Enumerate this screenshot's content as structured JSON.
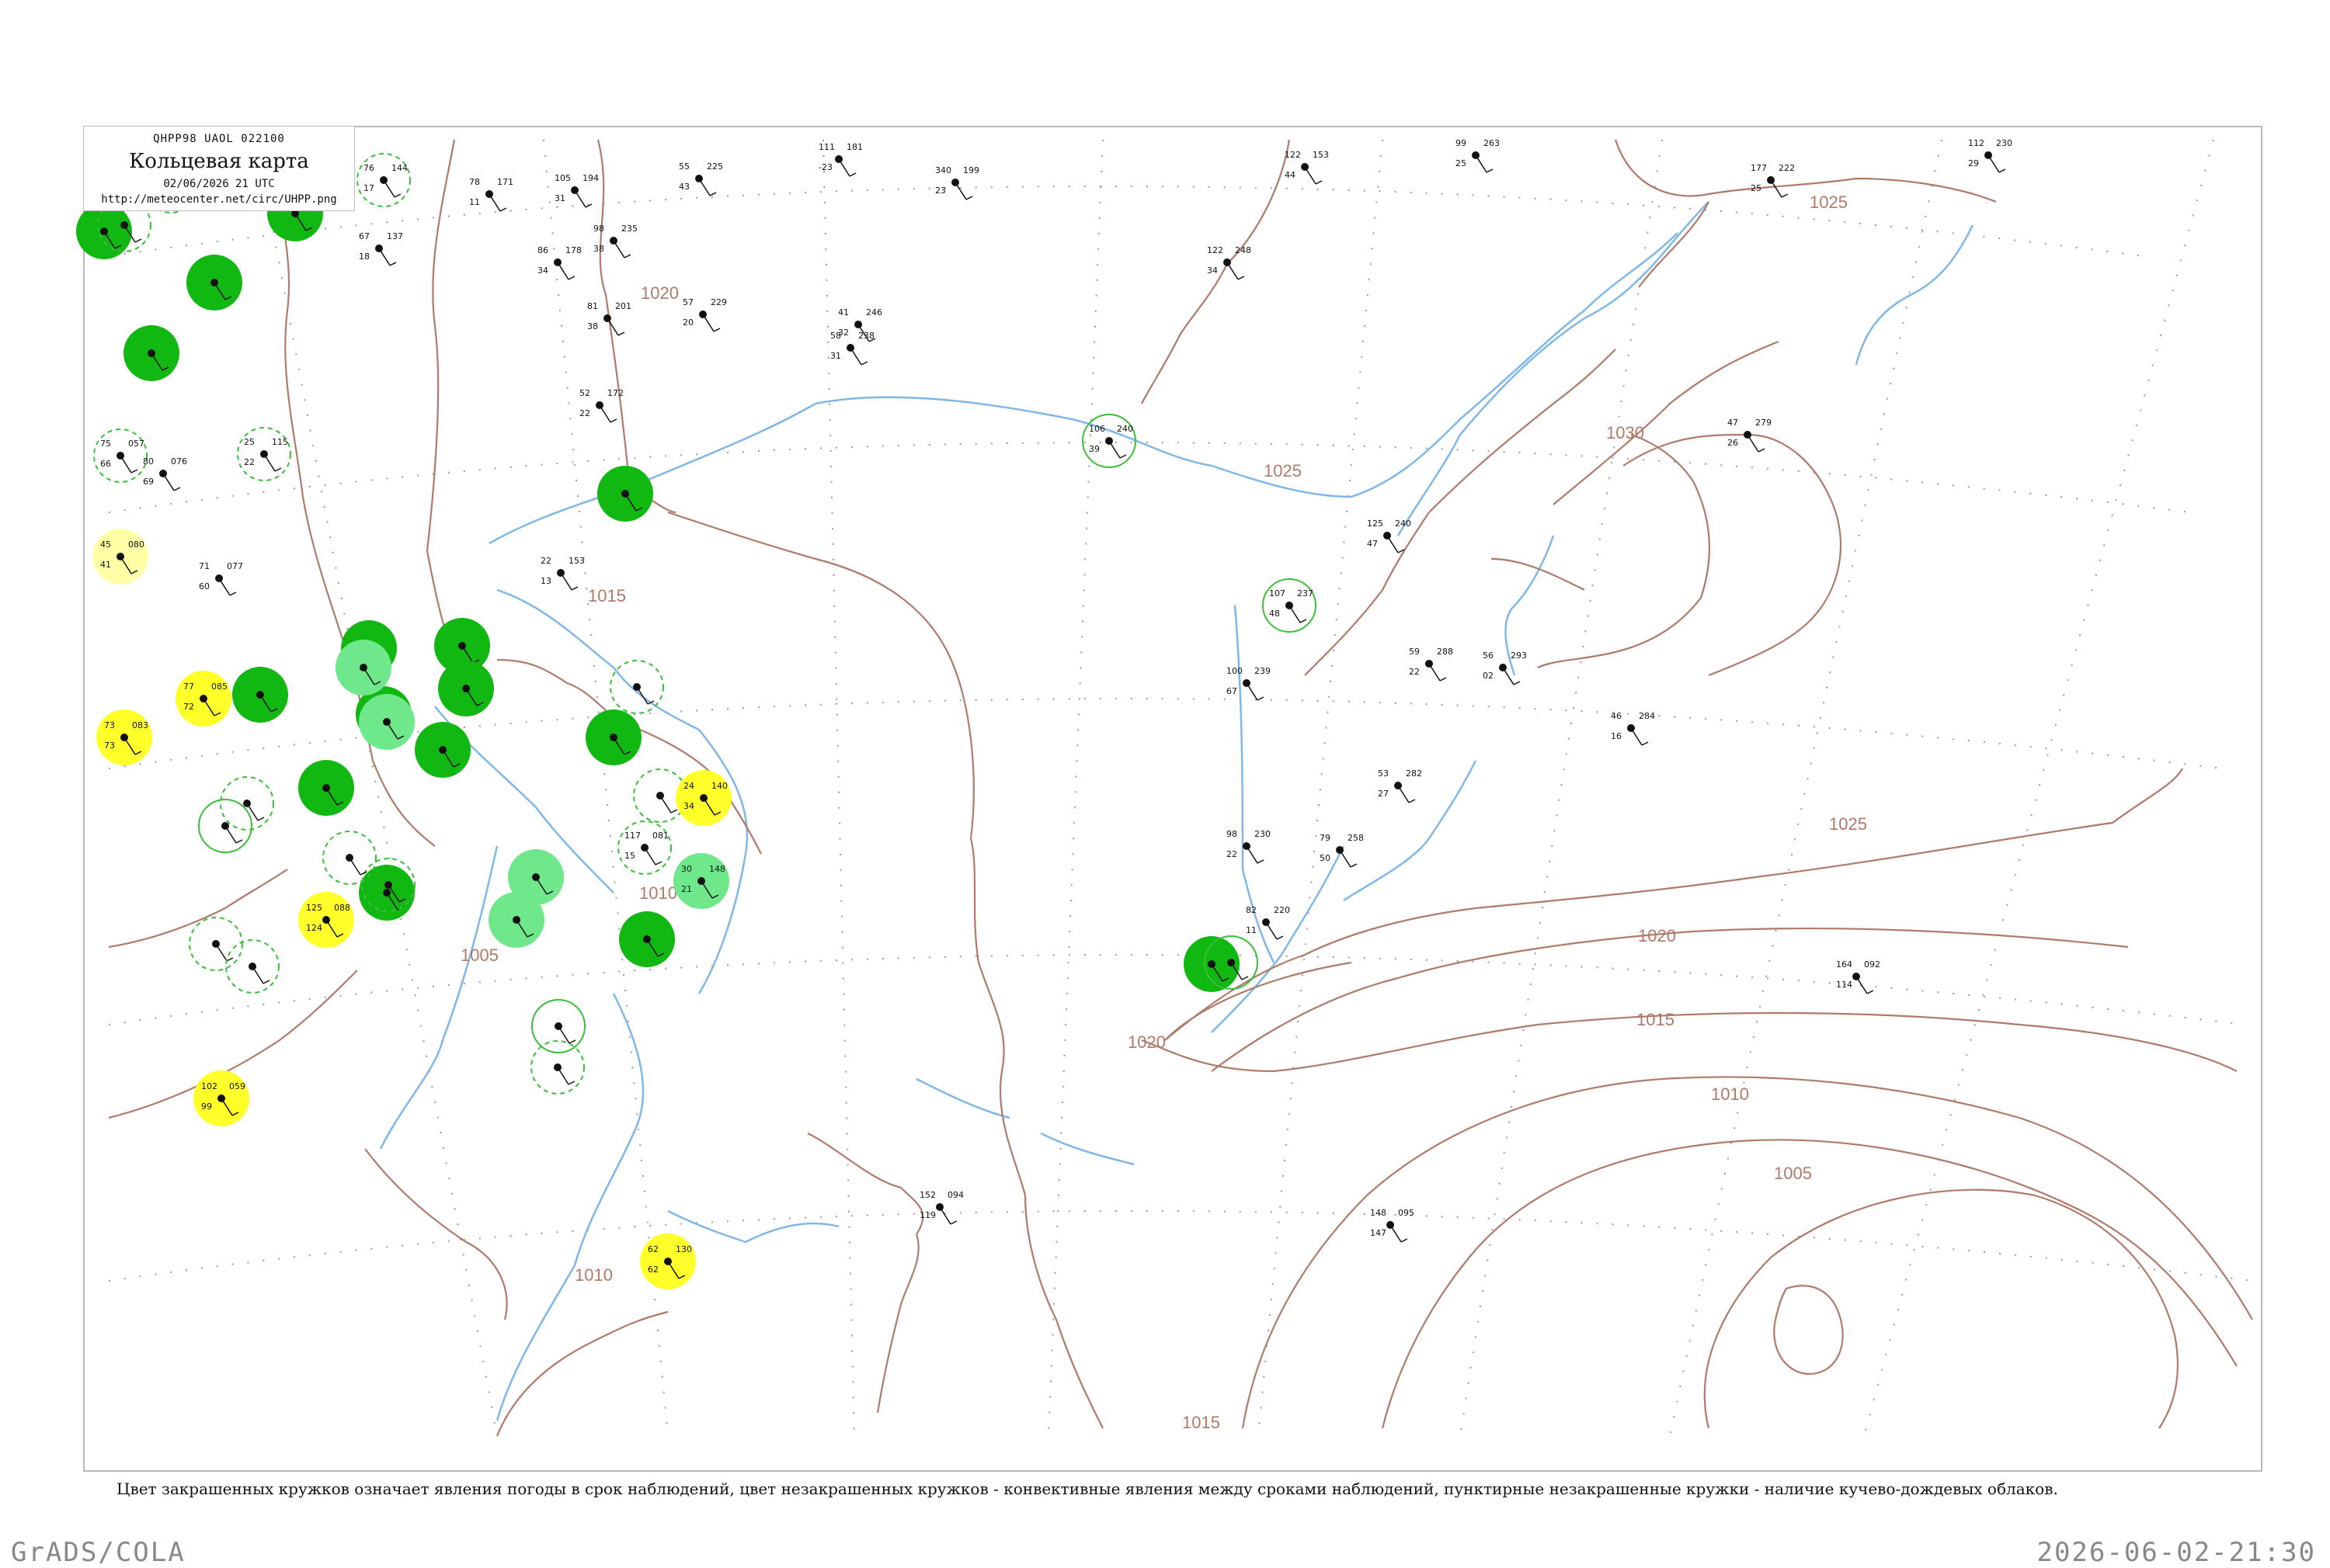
{
  "header": {
    "code": "QHPP98  UAOL  022100",
    "title": "Кольцевая карта",
    "time": "02/06/2026 21 UTC",
    "url": "http://meteocenter.net/circ/UHPP.png"
  },
  "footnote": "Цвет закрашенных кружков означает явления погоды в срок наблюдений, цвет незакрашенных кружков - конвективные явления между сроками наблюдений, пунктирные незакрашенные кружки - наличие кучево-дождевых облаков.",
  "credit": "GrADS/COLA",
  "timestamp": "2026-06-02-21:30",
  "isobar_labels": [
    "1025",
    "1020",
    "1030",
    "1025",
    "1015",
    "1025",
    "1020",
    "1015",
    "1010",
    "1005",
    "1020",
    "1010",
    "1005",
    "1010",
    "1015"
  ],
  "colors": {
    "isobar": "#b07a6a",
    "river": "#7fb8e8",
    "grid": "#9a9a9a",
    "station_green_dark": "#12b812",
    "station_green_light": "#6ee88a",
    "station_yellow": "#ffff2a",
    "station_pale_yellow": "#ffffa8",
    "text": "#111111",
    "footer_text": "#888888"
  },
  "stations": [
    {
      "label": "144",
      "t": "76",
      "td": "17"
    },
    {
      "label": "171",
      "t": "78",
      "td": "11"
    },
    {
      "label": "194",
      "t": "105",
      "td": "31"
    },
    {
      "label": "225",
      "t": "55",
      "td": "43"
    },
    {
      "label": "181",
      "t": "111",
      "td": "-23"
    },
    {
      "label": "199",
      "t": "340",
      "td": "23"
    },
    {
      "label": "153",
      "t": "122",
      "td": "44"
    },
    {
      "label": "263",
      "t": "99",
      "td": "25"
    },
    {
      "label": "222",
      "t": "177",
      "td": "25"
    },
    {
      "label": "230",
      "t": "112",
      "td": "29"
    },
    {
      "label": "137",
      "t": "67",
      "td": "18"
    },
    {
      "label": "235",
      "t": "98",
      "td": "38"
    },
    {
      "label": "178",
      "t": "86",
      "td": "34"
    },
    {
      "label": "248",
      "t": "122",
      "td": "34"
    },
    {
      "label": "201",
      "t": "81",
      "td": "38"
    },
    {
      "label": "229",
      "t": "57",
      "td": "20"
    },
    {
      "label": "246",
      "t": "41",
      "td": "32"
    },
    {
      "label": "238",
      "t": "58",
      "td": "31"
    },
    {
      "label": "172",
      "t": "52",
      "td": "22"
    },
    {
      "label": "240",
      "t": "106",
      "td": "39"
    },
    {
      "label": "279",
      "t": "47",
      "td": "26"
    },
    {
      "label": "057",
      "t": "75",
      "td": "66"
    },
    {
      "label": "115",
      "t": "25",
      "td": "22"
    },
    {
      "label": "076",
      "t": "80",
      "td": "69"
    },
    {
      "label": "080",
      "t": "45",
      "td": "41"
    },
    {
      "label": "077",
      "t": "71",
      "td": "60"
    },
    {
      "label": "153",
      "t": "22",
      "td": "13"
    },
    {
      "label": "240",
      "t": "125",
      "td": "47"
    },
    {
      "label": "237",
      "t": "107",
      "td": "48"
    },
    {
      "label": "288",
      "t": "59",
      "td": "22"
    },
    {
      "label": "293",
      "t": "56",
      "td": "02"
    },
    {
      "label": "239",
      "t": "100",
      "td": "67"
    },
    {
      "label": "284",
      "t": "46",
      "td": "16"
    },
    {
      "label": "282",
      "t": "53",
      "td": "27"
    },
    {
      "label": "230",
      "t": "98",
      "td": "22"
    },
    {
      "label": "258",
      "t": "79",
      "td": "50"
    },
    {
      "label": "220",
      "t": "82",
      "td": "11"
    },
    {
      "label": "092",
      "t": "164",
      "td": "114"
    },
    {
      "label": "094",
      "t": "152",
      "td": "119"
    },
    {
      "label": "130",
      "t": "62",
      "td": "62"
    },
    {
      "label": "140",
      "t": "24",
      "td": "34"
    },
    {
      "label": "148",
      "t": "30",
      "td": "21"
    },
    {
      "label": "081",
      "t": "117",
      "td": "15"
    },
    {
      "label": "088",
      "t": "125",
      "td": "124"
    },
    {
      "label": "059",
      "t": "102",
      "td": "99"
    },
    {
      "label": "083",
      "t": "73",
      "td": "73"
    },
    {
      "label": "085",
      "t": "77",
      "td": "72"
    },
    {
      "label": "095",
      "t": "148",
      "td": "147"
    }
  ]
}
